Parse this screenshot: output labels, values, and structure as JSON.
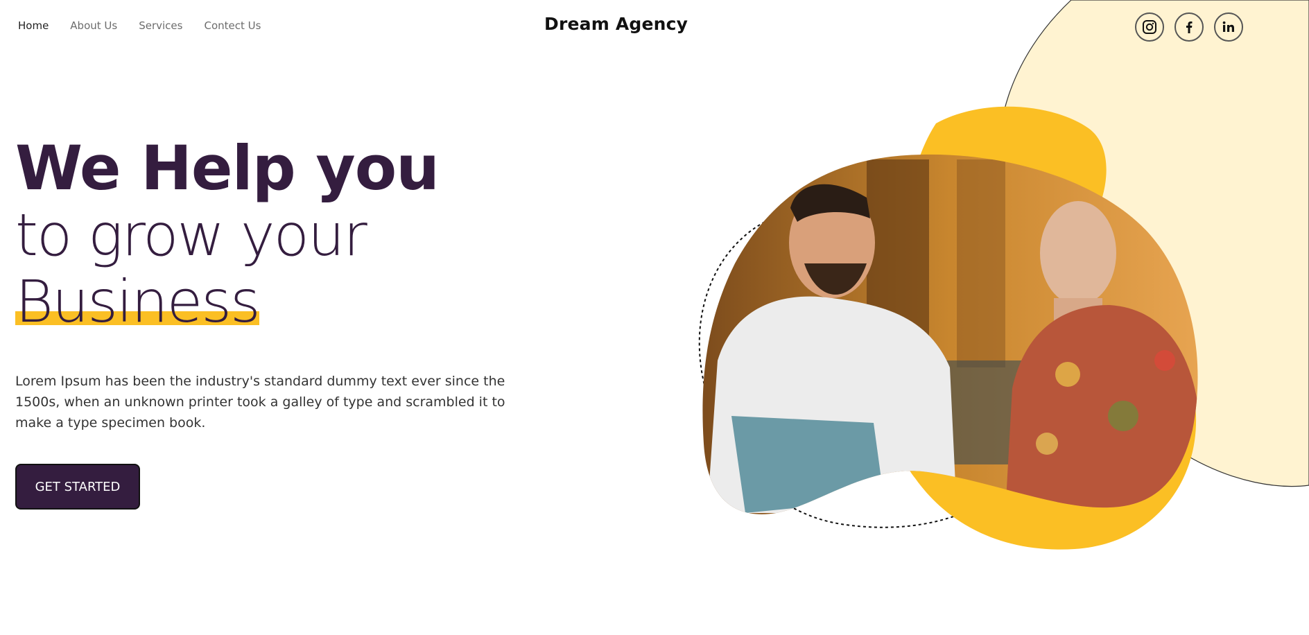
{
  "nav": {
    "items": [
      {
        "label": "Home",
        "active": true
      },
      {
        "label": "About Us",
        "active": false
      },
      {
        "label": "Services",
        "active": false
      },
      {
        "label": "Contect Us",
        "active": false
      }
    ]
  },
  "brand": "Dream Agency",
  "social": [
    "instagram-icon",
    "facebook-icon",
    "linkedin-icon"
  ],
  "hero": {
    "line1": "We Help you",
    "line2": "to grow your",
    "line3": "Business",
    "description": "Lorem Ipsum has been the industry's standard dummy text ever since the 1500s, when an unknown printer took a galley of type and scrambled it to make a type specimen book.",
    "cta": "GET STARTED"
  },
  "colors": {
    "primary": "#341d3f",
    "accent": "#fbbf24",
    "cream": "#fff3d1"
  }
}
